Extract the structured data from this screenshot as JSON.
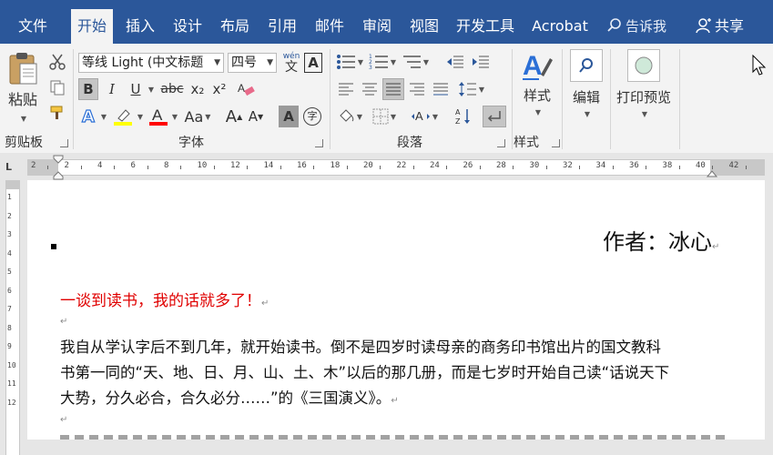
{
  "tabs": [
    "文件",
    "开始",
    "插入",
    "设计",
    "布局",
    "引用",
    "邮件",
    "审阅",
    "视图",
    "开发工具",
    "Acrobat"
  ],
  "active_tab": "开始",
  "tell_me": "告诉我",
  "share": "共享",
  "clipboard": {
    "paste": "粘贴",
    "group": "剪贴板"
  },
  "font": {
    "name": "等线 Light (中文标题",
    "size": "四号",
    "phonetic": "wén",
    "clear_format": "abc",
    "sub": "x₂",
    "sup": "x²",
    "change_case": "Aa",
    "char_border": "A",
    "enclose": "字",
    "group": "字体"
  },
  "paragraph": {
    "group": "段落"
  },
  "styles": {
    "label": "样式",
    "group": "样式"
  },
  "editing": {
    "label": "编辑"
  },
  "print_preview": {
    "label": "打印预览"
  },
  "colors": {
    "ribbon_blue": "#2b579a",
    "highlight": "#ffff00",
    "font_red": "#ff0000",
    "heading_red": "#e00000"
  },
  "ruler": [
    "2",
    "2",
    "4",
    "6",
    "8",
    "10",
    "12",
    "14",
    "16",
    "18",
    "20",
    "22",
    "24",
    "26",
    "28",
    "30",
    "32",
    "34",
    "36",
    "38",
    "40",
    "42"
  ],
  "vruler": [
    "1",
    "2",
    "3",
    "4",
    "5",
    "6",
    "7",
    "8",
    "9",
    "10",
    "11",
    "12"
  ],
  "document": {
    "author": "作者：冰心",
    "heading": "一谈到读书，我的话就多了！",
    "para1": [
      "我自从学认字后不到几年，就开始读书。倒不是四岁时读母亲的商务印书馆出片的国文教科",
      "书第一同的“天、地、日、月、山、土、木”以后的那几册，而是七岁时开始自己读“话说天下",
      "大势，分久必合，合久必分……”的《三国演义》。"
    ],
    "para_mark": "↵"
  }
}
